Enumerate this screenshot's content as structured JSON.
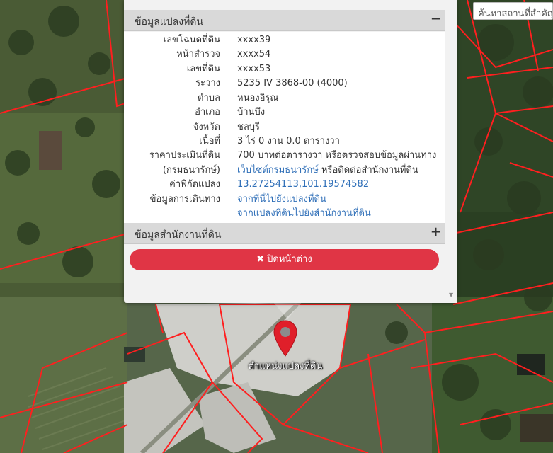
{
  "search": {
    "placeholder": "ค้นหาสถานที่สำคัญ"
  },
  "parcel_panel": {
    "title": "ข้อมูลแปลงที่ดิน",
    "toggle": "−",
    "rows": [
      {
        "label": "เลขโฉนดที่ดิน",
        "value": "xxxx39"
      },
      {
        "label": "หน้าสำรวจ",
        "value": "xxxx54"
      },
      {
        "label": "เลขที่ดิน",
        "value": "xxxx53"
      },
      {
        "label": "ระวาง",
        "value": "5235 IV 3868-00 (4000)"
      },
      {
        "label": "ตำบล",
        "value": "หนองอิรุณ"
      },
      {
        "label": "อำเภอ",
        "value": "บ้านบึง"
      },
      {
        "label": "จังหวัด",
        "value": "ชลบุรี"
      },
      {
        "label": "เนื้อที่",
        "value": "3 ไร่ 0 งาน 0.0 ตารางวา"
      },
      {
        "label": "ราคาประเมินที่ดิน",
        "value": "700 บาทต่อตารางวา หรือตรวจสอบข้อมูลผ่านทาง"
      },
      {
        "label": "(กรมธนารักษ์)",
        "link": "เว็บไซต์กรมธนารักษ์",
        "value": " หรือติดต่อสำนักงานที่ดิน"
      },
      {
        "label": "ค่าพิกัดแปลง",
        "link": "13.27254113,101.19574582"
      },
      {
        "label": "ข้อมูลการเดินทาง",
        "link": "จากที่นี่ไปยังแปลงที่ดิน"
      },
      {
        "label": "",
        "link": "จากแปลงที่ดินไปยังสำนักงานที่ดิน"
      }
    ]
  },
  "office_panel": {
    "title": "ข้อมูลสำนักงานที่ดิน",
    "toggle": "+"
  },
  "close_button": {
    "icon": "close-icon",
    "label": "ปิดหน้าต่าง",
    "color": "#e03545"
  },
  "marker": {
    "label": "ตำแหน่งแปลงที่ดิน",
    "color": "#e01f2a"
  },
  "colors": {
    "boundary": "#ff1f1f",
    "link": "#2f6fb8"
  }
}
